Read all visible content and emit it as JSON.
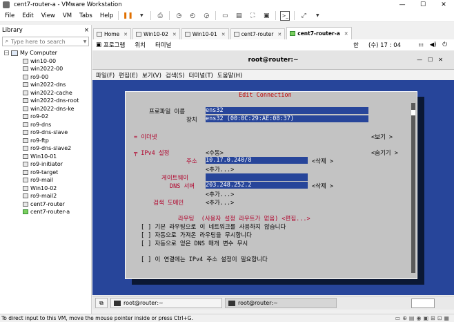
{
  "window": {
    "title": "cent7-router-a - VMware Workstation",
    "controls": [
      "—",
      "☐",
      "✕"
    ]
  },
  "menu": [
    "File",
    "Edit",
    "View",
    "VM",
    "Tabs",
    "Help"
  ],
  "library": {
    "title": "Library",
    "close": "×",
    "search_placeholder": "Type here to search",
    "root": "My Computer",
    "items": [
      {
        "label": "win10-00",
        "on": false
      },
      {
        "label": "win2022-00",
        "on": false
      },
      {
        "label": "ro9-00",
        "on": false
      },
      {
        "label": "win2022-dns",
        "on": false
      },
      {
        "label": "win2022-cache",
        "on": false
      },
      {
        "label": "win2022-dns-root",
        "on": false
      },
      {
        "label": "win2022-dns-ke",
        "on": false
      },
      {
        "label": "ro9-02",
        "on": false
      },
      {
        "label": "ro9-dns",
        "on": false
      },
      {
        "label": "ro9-dns-slave",
        "on": false
      },
      {
        "label": "ro9-ftp",
        "on": false
      },
      {
        "label": "ro9-dns-slave2",
        "on": false
      },
      {
        "label": "Win10-01",
        "on": false
      },
      {
        "label": "ro9-initiator",
        "on": false
      },
      {
        "label": "ro9-target",
        "on": false
      },
      {
        "label": "ro9-mail",
        "on": false
      },
      {
        "label": "Win10-02",
        "on": false
      },
      {
        "label": "ro9-mail2",
        "on": false
      },
      {
        "label": "cent7-router",
        "on": false
      },
      {
        "label": "cent7-router-a",
        "on": true
      }
    ]
  },
  "tabs": [
    {
      "label": "Home",
      "active": false
    },
    {
      "label": "Win10-02",
      "active": false
    },
    {
      "label": "Win10-01",
      "active": false
    },
    {
      "label": "cent7-router",
      "active": false
    },
    {
      "label": "cent7-router-a",
      "active": true
    }
  ],
  "gnome": {
    "apps": "프로그램",
    "places": "위치",
    "terminal": "터미널",
    "lang": "한",
    "clock": "(수) 17 : 04"
  },
  "terminal": {
    "title": "root@router:~",
    "menu": [
      "파일(F)",
      "편집(E)",
      "보기(V)",
      "검색(S)",
      "터미널(T)",
      "도움말(H)"
    ]
  },
  "dialog": {
    "title": "Edit Connection",
    "profile_label": "프로파일 이름",
    "profile_value": "ens32",
    "device_label": "장치",
    "device_value": "ens32 (00:0C:29:AE:08:37)",
    "ethernet": "= 이더넷",
    "show": "<보기 >",
    "ipv4": "╤ IPv4 설정",
    "ipv4_mode": "<수동>",
    "hide": "<숨기기 >",
    "address_label": "주소",
    "address_value": "10.17.0.240/8",
    "delete1": "<삭제 >",
    "add1": "<추가...>",
    "gateway_label": "게이트웨이",
    "dns_label": "DNS 서버",
    "dns_value": "203.248.252.2",
    "delete2": "<삭제 >",
    "add2": "<추가...>",
    "search_label": "검색 도메인",
    "add3": "<추가...>",
    "routing": "라우팅  (사용자 설정 라우트가 없음) <편집...>",
    "cb1": "[ ] 기본 라우팅으로 이 네트워크를 사용하지 않습니다",
    "cb2": "[ ] 자동으로 가져온 라우팅을 무시합니다",
    "cb3": "[ ] 자동으로 얻은 DNS 매개 변수 무시",
    "cb4": "[ ] 이 연결에는 IPv4 주소 설정이 필요합니다"
  },
  "vm_taskbar": {
    "btn1": "root@router:~",
    "btn2": "root@router:~"
  },
  "status": {
    "text": "To direct input to this VM, move the mouse pointer inside or press Ctrl+G."
  }
}
